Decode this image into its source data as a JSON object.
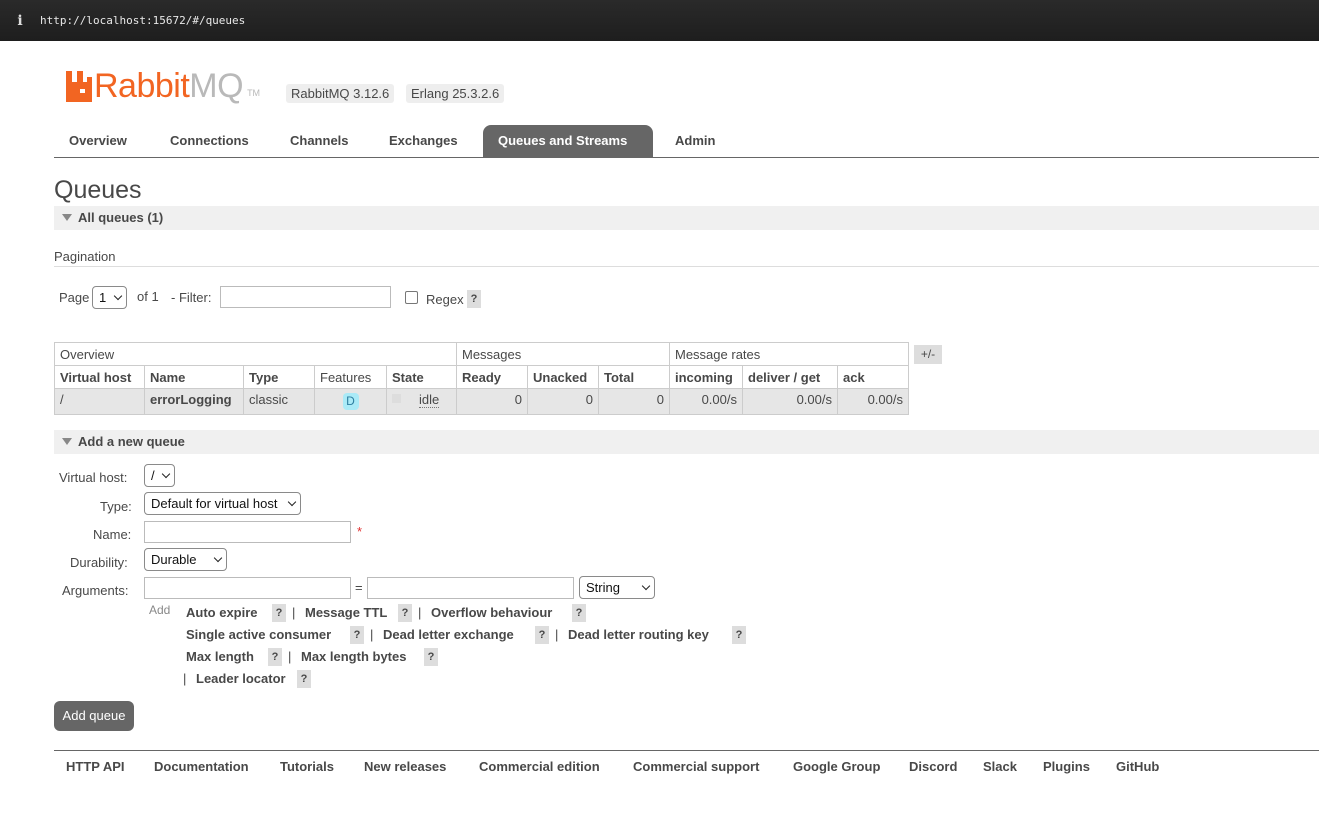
{
  "browser": {
    "url": "http://localhost:15672/#/queues",
    "info_glyph": "i"
  },
  "logo": {
    "rabbit": "Rabbit",
    "mq": "MQ",
    "tm": "TM"
  },
  "versions": {
    "rabbitmq": "RabbitMQ 3.12.6",
    "erlang": "Erlang 25.3.2.6"
  },
  "tabs": [
    {
      "label": "Overview"
    },
    {
      "label": "Connections"
    },
    {
      "label": "Channels"
    },
    {
      "label": "Exchanges"
    },
    {
      "label": "Queues and Streams",
      "active": true
    },
    {
      "label": "Admin"
    }
  ],
  "page_title": "Queues",
  "all_queues": "All queues (1)",
  "pagination": {
    "label": "Pagination",
    "page_label": "Page",
    "page_value": "1",
    "of_label": "of 1",
    "filter_label": "- Filter:",
    "filter_value": "",
    "regex_label": "Regex",
    "help": "?"
  },
  "table": {
    "groups": [
      "Overview",
      "Messages",
      "Message rates"
    ],
    "columns": [
      "Virtual host",
      "Name",
      "Type",
      "Features",
      "State",
      "Ready",
      "Unacked",
      "Total",
      "incoming",
      "deliver / get",
      "ack"
    ],
    "rows": [
      {
        "vhost": "/",
        "name": "errorLogging",
        "type": "classic",
        "feature": "D",
        "state": "idle",
        "ready": "0",
        "unacked": "0",
        "total": "0",
        "incoming": "0.00/s",
        "deliver_get": "0.00/s",
        "ack": "0.00/s"
      }
    ],
    "toggle": "+/-"
  },
  "add_queue": {
    "header": "Add a new queue",
    "vhost_label": "Virtual host:",
    "vhost_value": "/",
    "type_label": "Type:",
    "type_value": "Default for virtual host",
    "name_label": "Name:",
    "name_value": "",
    "required_mark": "*",
    "durability_label": "Durability:",
    "durability_value": "Durable",
    "arguments_label": "Arguments:",
    "equals": "=",
    "arg_type_value": "String",
    "add_label": "Add",
    "arg_links": {
      "auto_expire": "Auto expire",
      "message_ttl": "Message TTL",
      "overflow": "Overflow behaviour",
      "single_active": "Single active consumer",
      "dlx": "Dead letter exchange",
      "dlrk": "Dead letter routing key",
      "max_length": "Max length",
      "max_length_bytes": "Max length bytes",
      "leader_locator": "Leader locator"
    },
    "submit_label": "Add queue"
  },
  "footer": [
    "HTTP API",
    "Documentation",
    "Tutorials",
    "New releases",
    "Commercial edition",
    "Commercial support",
    "Google Group",
    "Discord",
    "Slack",
    "Plugins",
    "GitHub"
  ],
  "colors": {
    "accent": "#f26522",
    "active_tab": "#666666",
    "header_bg": "#f0f0f0",
    "row_bg": "#e6e6e6"
  }
}
